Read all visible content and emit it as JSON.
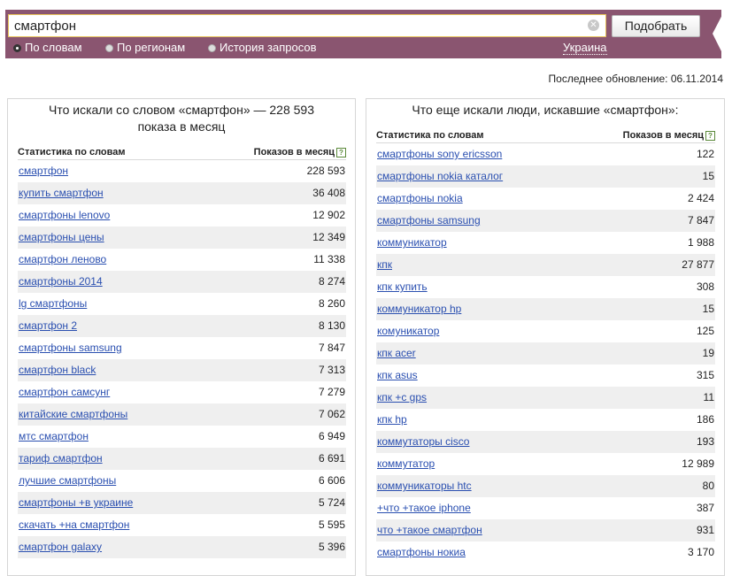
{
  "search": {
    "value": "смартфон",
    "button_label": "Подобрать"
  },
  "modes": [
    {
      "label": "По словам",
      "selected": true
    },
    {
      "label": "По регионам",
      "selected": false
    },
    {
      "label": "История запросов",
      "selected": false
    }
  ],
  "region": "Украина",
  "last_update": "Последнее обновление: 06.11.2014",
  "left": {
    "title_line1": "Что искали со словом «смартфон» — 228 593",
    "title_line2": "показа в месяц",
    "col_phrase": "Статистика по словам",
    "col_count": "Показов в месяц",
    "rows": [
      {
        "phrase": "смартфон",
        "count": "228 593"
      },
      {
        "phrase": "купить смартфон",
        "count": "36 408"
      },
      {
        "phrase": "смартфоны lenovo",
        "count": "12 902"
      },
      {
        "phrase": "смартфоны цены",
        "count": "12 349"
      },
      {
        "phrase": "смартфон леново",
        "count": "11 338"
      },
      {
        "phrase": "смартфоны 2014",
        "count": "8 274"
      },
      {
        "phrase": "lg смартфоны",
        "count": "8 260"
      },
      {
        "phrase": "смартфон 2",
        "count": "8 130"
      },
      {
        "phrase": "смартфоны samsung",
        "count": "7 847"
      },
      {
        "phrase": "смартфон black",
        "count": "7 313"
      },
      {
        "phrase": "смартфон самсунг",
        "count": "7 279"
      },
      {
        "phrase": "китайские смартфоны",
        "count": "7 062"
      },
      {
        "phrase": "мтс смартфон",
        "count": "6 949"
      },
      {
        "phrase": "тариф смартфон",
        "count": "6 691"
      },
      {
        "phrase": "лучшие смартфоны",
        "count": "6 606"
      },
      {
        "phrase": "смартфоны +в украине",
        "count": "5 724"
      },
      {
        "phrase": "скачать +на смартфон",
        "count": "5 595"
      },
      {
        "phrase": "смартфон galaxy",
        "count": "5 396"
      }
    ]
  },
  "right": {
    "title": "Что еще искали люди, искавшие «смартфон»:",
    "col_phrase": "Статистика по словам",
    "col_count": "Показов в месяц",
    "rows": [
      {
        "phrase": "смартфоны sony ericsson",
        "count": "122"
      },
      {
        "phrase": "смартфоны nokia каталог",
        "count": "15"
      },
      {
        "phrase": "смартфоны nokia",
        "count": "2 424"
      },
      {
        "phrase": "смартфоны samsung",
        "count": "7 847"
      },
      {
        "phrase": "коммуникатор",
        "count": "1 988"
      },
      {
        "phrase": "кпк",
        "count": "27 877"
      },
      {
        "phrase": "кпк купить",
        "count": "308"
      },
      {
        "phrase": "коммуникатор hp",
        "count": "15"
      },
      {
        "phrase": "комуникатор",
        "count": "125"
      },
      {
        "phrase": "кпк acer",
        "count": "19"
      },
      {
        "phrase": "кпк asus",
        "count": "315"
      },
      {
        "phrase": "кпк +с gps",
        "count": "11"
      },
      {
        "phrase": "кпк hp",
        "count": "186"
      },
      {
        "phrase": "коммутаторы cisco",
        "count": "193"
      },
      {
        "phrase": "коммутатор",
        "count": "12 989"
      },
      {
        "phrase": "коммуникаторы htc",
        "count": "80"
      },
      {
        "phrase": "+что +такое iphone",
        "count": "387"
      },
      {
        "phrase": "что +такое смартфон",
        "count": "931"
      },
      {
        "phrase": "смартфоны нокиа",
        "count": "3 170"
      }
    ]
  }
}
